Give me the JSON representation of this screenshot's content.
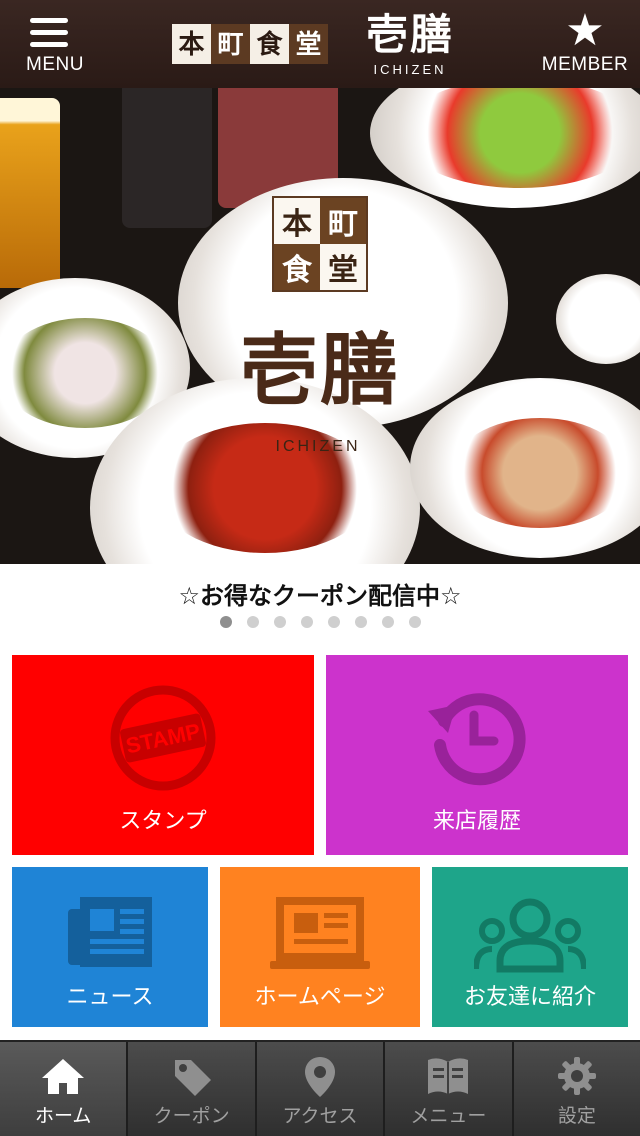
{
  "header": {
    "menu_label": "MENU",
    "member_label": "MEMBER",
    "logo_chars": [
      "本",
      "町",
      "食",
      "堂"
    ],
    "brand_name": "壱膳",
    "brand_sub": "ICHIZEN",
    "bg_color": "#2f1e19"
  },
  "hero": {
    "logo_chars": [
      "本",
      "町",
      "食",
      "堂"
    ],
    "brand_name": "壱膳",
    "brand_sub": "ICHIZEN",
    "caption": "☆お得なクーポン配信中☆",
    "slide_count": 8,
    "active_slide": 1
  },
  "tiles": [
    {
      "label": "スタンプ",
      "icon": "stamp-icon",
      "color": "#ff0000"
    },
    {
      "label": "来店履歴",
      "icon": "history-icon",
      "color": "#cc33cc"
    },
    {
      "label": "ニュース",
      "icon": "newspaper-icon",
      "color": "#1f84d6"
    },
    {
      "label": "ホームページ",
      "icon": "webpage-icon",
      "color": "#ff8220"
    },
    {
      "label": "お友達に紹介",
      "icon": "people-icon",
      "color": "#1ea58a"
    }
  ],
  "stamp_text": "STAMP",
  "tabbar": {
    "tabs": [
      {
        "label": "ホーム",
        "icon": "home-icon",
        "active": true
      },
      {
        "label": "クーポン",
        "icon": "tag-icon",
        "active": false
      },
      {
        "label": "アクセス",
        "icon": "map-pin-icon",
        "active": false
      },
      {
        "label": "メニュー",
        "icon": "book-icon",
        "active": false
      },
      {
        "label": "設定",
        "icon": "gear-icon",
        "active": false
      }
    ]
  }
}
